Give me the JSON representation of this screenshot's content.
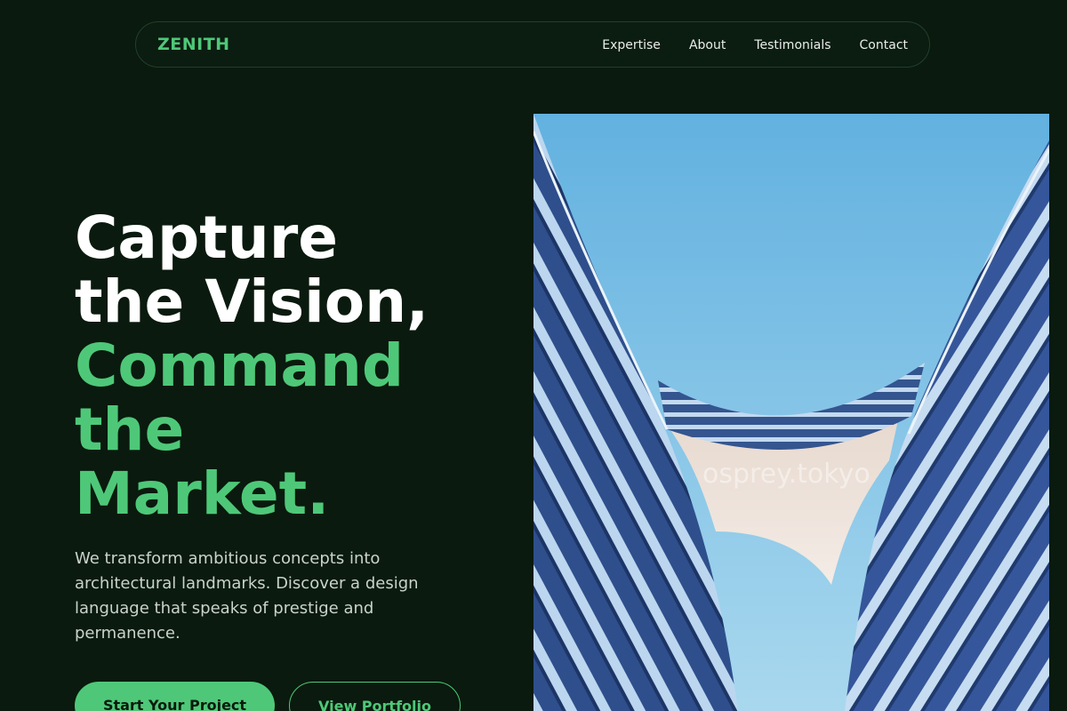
{
  "nav": {
    "logo": "ZENITH",
    "links": [
      "Expertise",
      "About",
      "Testimonials",
      "Contact"
    ]
  },
  "hero": {
    "title_lines": [
      "Capture",
      "the Vision,"
    ],
    "accent_lines": [
      "Command",
      "the",
      "Market."
    ],
    "description": "We transform ambitious concepts into architectural landmarks. Discover a design language that speaks of prestige and permanence.",
    "primary_button": "Start Your Project",
    "secondary_button": "View Portfolio"
  },
  "image": {
    "watermark": "osprey.tokyo"
  },
  "colors": {
    "background": "#0a1a0e",
    "accent": "#4ec878",
    "text": "#ffffff"
  }
}
